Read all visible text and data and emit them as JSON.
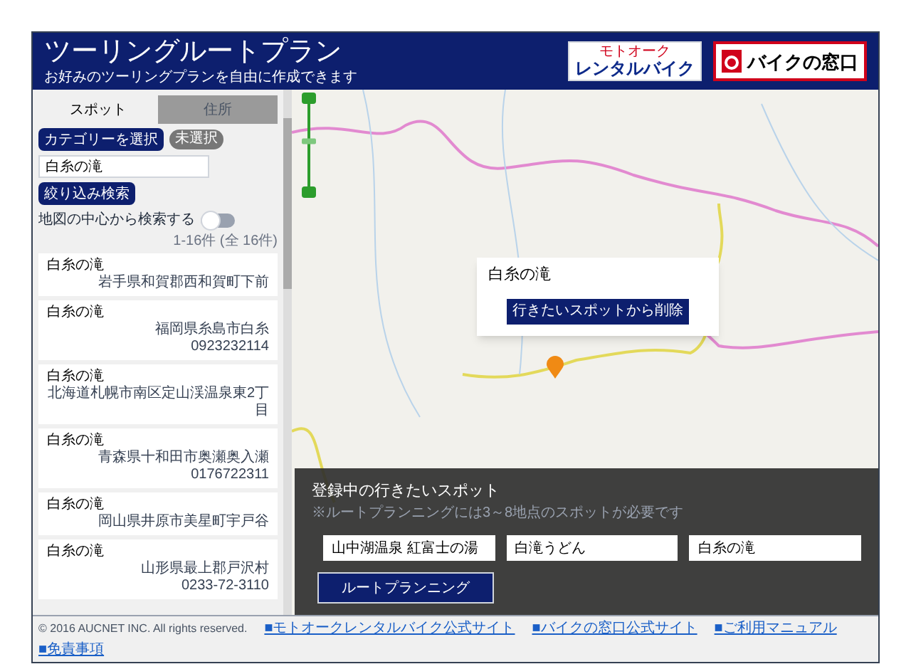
{
  "header": {
    "title": "ツーリングルートプラン",
    "subtitle": "お好みのツーリングプランを自由に作成できます",
    "logos": [
      {
        "kind": "rental",
        "small": "モトオーク",
        "main": "レンタルバイク"
      },
      {
        "kind": "window",
        "main": "バイクの窓口"
      }
    ]
  },
  "sidebar": {
    "tabs": [
      {
        "label": "スポット",
        "selected": true
      },
      {
        "label": "住所",
        "selected": false
      }
    ],
    "category_button": "カテゴリーを選択",
    "category_badge": "未選択",
    "search": {
      "value": "白糸の滝"
    },
    "search_button": "絞り込み検索",
    "center_toggle": {
      "label": "地図の中心から検索する",
      "on": false
    },
    "count": "1-16件 (全 16件)",
    "results": [
      {
        "name": "白糸の滝",
        "address": "岩手県和賀郡西和賀町下前"
      },
      {
        "name": "白糸の滝",
        "address": "福岡県糸島市白糸",
        "phone": "0923232114"
      },
      {
        "name": "白糸の滝",
        "address": "北海道札幌市南区定山渓温泉東2丁目"
      },
      {
        "name": "白糸の滝",
        "address": "青森県十和田市奥瀬奥入瀬",
        "phone": "0176722311"
      },
      {
        "name": "白糸の滝",
        "address": "岡山県井原市美星町宇戸谷"
      },
      {
        "name": "白糸の滝",
        "address": "山形県最上郡戸沢村",
        "phone": "0233-72-3110"
      }
    ]
  },
  "map": {
    "zoom": {
      "level": 0.55
    },
    "popup": {
      "title": "白糸の滝",
      "button": "行きたいスポットから削除"
    }
  },
  "planner": {
    "title": "登録中の行きたいスポット",
    "note": "※ルートプランニングには3～8地点のスポットが必要です",
    "spots": [
      "山中湖温泉 紅富士の湯",
      "白滝うどん",
      "白糸の滝"
    ],
    "button": "ルートプランニング"
  },
  "footer": {
    "copyright": "© 2016 AUCNET INC. All rights reserved.",
    "links": [
      "■モトオークレンタルバイク公式サイト",
      "■バイクの窓口公式サイト",
      "■ご利用マニュアル",
      "■免責事項"
    ]
  }
}
